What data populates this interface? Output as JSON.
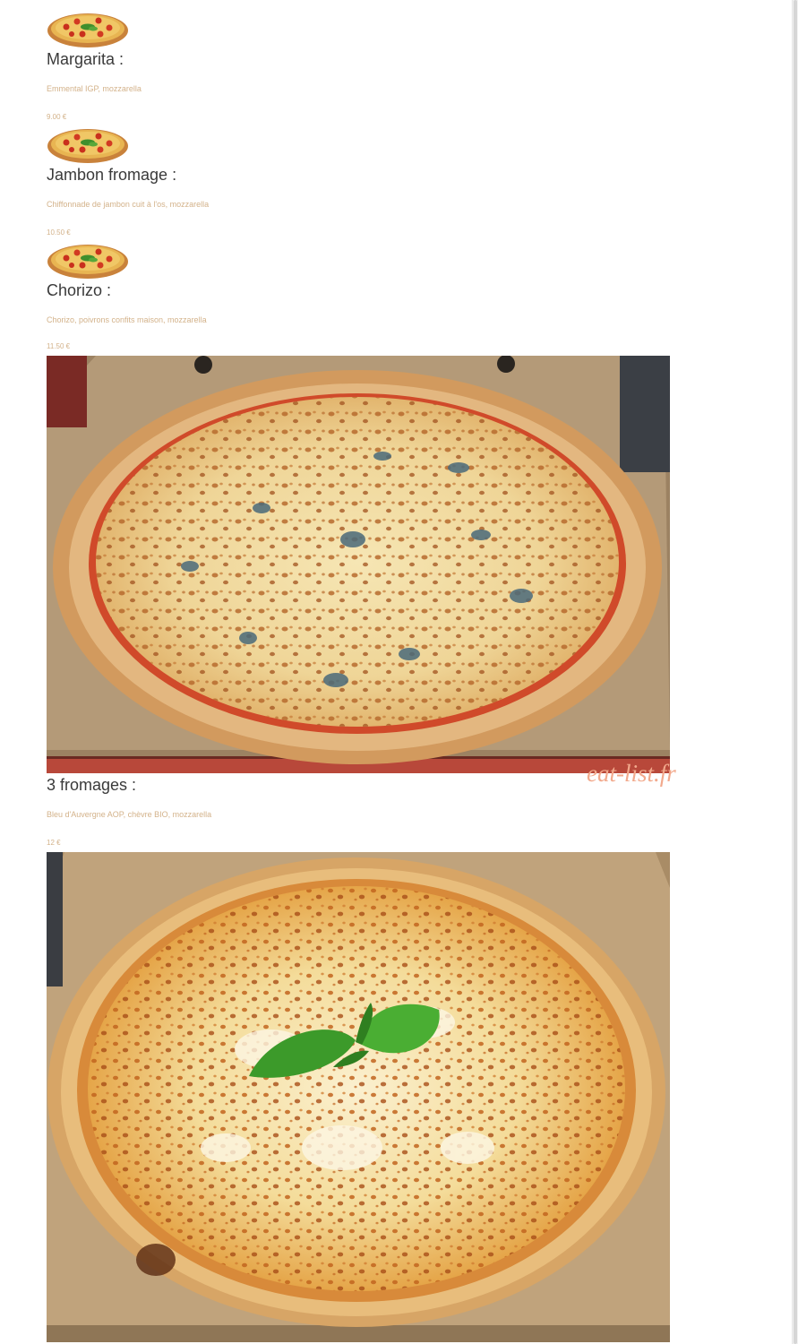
{
  "menu": {
    "items": [
      {
        "name": "Margarita :",
        "description": "Emmental IGP, mozzarella",
        "price": "9.00 €",
        "thumbnail_icon": "pizza-icon"
      },
      {
        "name": "Jambon fromage :",
        "description": "Chiffonnade de jambon cuit à l'os, mozzarella",
        "price": "10.50 €",
        "thumbnail_icon": "pizza-icon"
      },
      {
        "name": "Chorizo :",
        "description": "Chorizo, poivrons confits maison, mozzarella",
        "price": "11.50 €",
        "thumbnail_icon": "pizza-icon"
      },
      {
        "name": "3 fromages :",
        "description": "Bleu d'Auvergne AOP, chèvre BIO, mozzarella",
        "price": "12 €",
        "thumbnail_icon": "pizza-photo"
      }
    ]
  },
  "watermark": "eat-list.fr",
  "colors": {
    "item_name": "#3a3a3a",
    "item_detail": "#d3b28a",
    "watermark": "#f2a98c"
  }
}
